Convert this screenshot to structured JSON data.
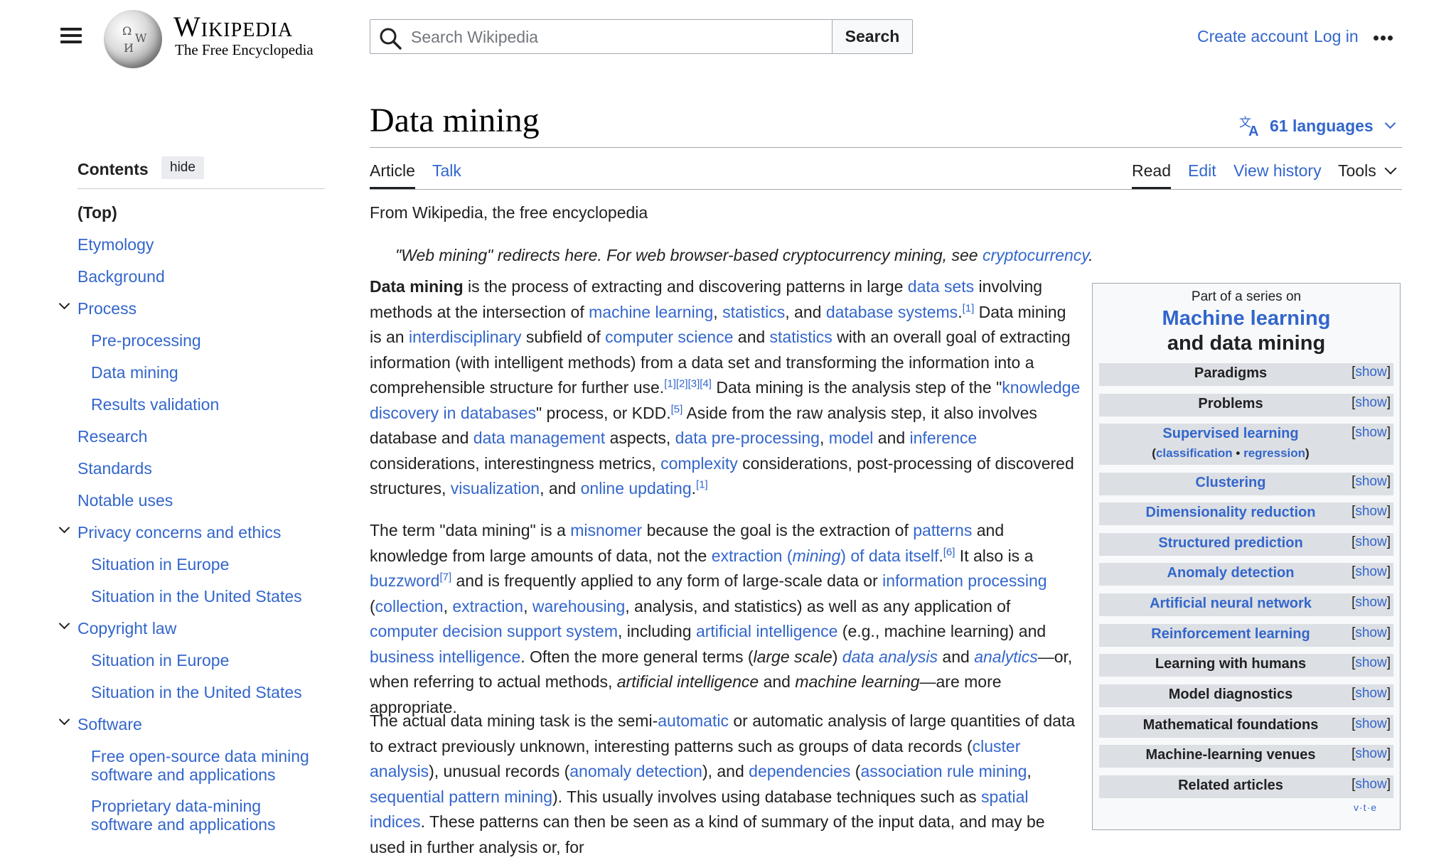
{
  "header": {
    "logo_wordmark": "Wikipedia",
    "logo_tagline": "The Free Encyclopedia",
    "search_placeholder": "Search Wikipedia",
    "search_button": "Search",
    "create_account": "Create account",
    "log_in": "Log in"
  },
  "page": {
    "title": "Data mining",
    "languages": "61 languages",
    "tabs_left": [
      "Article",
      "Talk"
    ],
    "tabs_right": [
      "Read",
      "Edit",
      "View history",
      "Tools"
    ]
  },
  "toc": {
    "title": "Contents",
    "hide": "hide",
    "items": [
      {
        "label": "(Top)"
      },
      {
        "label": "Etymology"
      },
      {
        "label": "Background"
      },
      {
        "label": "Process"
      },
      {
        "label": "Pre-processing"
      },
      {
        "label": "Data mining"
      },
      {
        "label": "Results validation"
      },
      {
        "label": "Research"
      },
      {
        "label": "Standards"
      },
      {
        "label": "Notable uses"
      },
      {
        "label": "Privacy concerns and ethics"
      },
      {
        "label": "Situation in Europe"
      },
      {
        "label": "Situation in the United States"
      },
      {
        "label": "Copyright law"
      },
      {
        "label": "Situation in Europe"
      },
      {
        "label": "Situation in the United States"
      },
      {
        "label": "Software"
      },
      {
        "label": "Free open-source data mining software and applications"
      },
      {
        "label": "Proprietary data-mining software and applications"
      }
    ]
  },
  "article": {
    "from": "From Wikipedia, the free encyclopedia",
    "hatnote_text": "\"Web mining\" redirects here. For web browser-based cryptocurrency mining, see ",
    "hatnote_link": "cryptocurrency",
    "hatnote_end": ".",
    "p1": [
      {
        "b": "Data mining"
      },
      {
        "t": " is the process of extracting and discovering patterns in large "
      },
      {
        "a": "data sets"
      },
      {
        "t": " involving methods at the intersection of "
      },
      {
        "a": "machine learning"
      },
      {
        "t": ", "
      },
      {
        "a": "statistics"
      },
      {
        "t": ", and "
      },
      {
        "a": "database systems"
      },
      {
        "t": "."
      },
      {
        "s": "[1]"
      },
      {
        "t": " Data mining is an "
      },
      {
        "a": "interdisciplinary"
      },
      {
        "t": " subfield of "
      },
      {
        "a": "computer science"
      },
      {
        "t": " and "
      },
      {
        "a": "statistics"
      },
      {
        "t": " with an overall goal of extracting information (with intelligent methods) from a data set and transforming the information into a comprehensible structure for further use."
      },
      {
        "s": "[1][2][3][4]"
      },
      {
        "t": " Data mining is the analysis step of the \""
      },
      {
        "a": "knowledge discovery in databases"
      },
      {
        "t": "\" process, or KDD."
      },
      {
        "s": "[5]"
      },
      {
        "t": " Aside from the raw analysis step, it also involves database and "
      },
      {
        "a": "data management"
      },
      {
        "t": " aspects, "
      },
      {
        "a": "data pre-processing"
      },
      {
        "t": ", "
      },
      {
        "a": "model"
      },
      {
        "t": " and "
      },
      {
        "a": "inference"
      },
      {
        "t": " considerations, interestingness metrics, "
      },
      {
        "a": "complexity"
      },
      {
        "t": " considerations, post-processing of discovered structures, "
      },
      {
        "a": "visualization"
      },
      {
        "t": ", and "
      },
      {
        "a": "online updating"
      },
      {
        "t": "."
      },
      {
        "s": "[1]"
      }
    ],
    "p2": [
      {
        "t": "The term \"data mining\" is a "
      },
      {
        "a": "misnomer"
      },
      {
        "t": " because the goal is the extraction of "
      },
      {
        "a": "patterns"
      },
      {
        "t": " and knowledge from large amounts of data, not the "
      },
      {
        "a": "extraction ("
      },
      {
        "ai": "mining"
      },
      {
        "a": ") of data itself"
      },
      {
        "t": "."
      },
      {
        "s": "[6]"
      },
      {
        "t": " It also is a "
      },
      {
        "a": "buzzword"
      },
      {
        "s": "[7]"
      },
      {
        "t": " and is frequently applied to any form of large-scale data or "
      },
      {
        "a": "information processing"
      },
      {
        "t": " ("
      },
      {
        "a": "collection"
      },
      {
        "t": ", "
      },
      {
        "a": "extraction"
      },
      {
        "t": ", "
      },
      {
        "a": "warehousing"
      },
      {
        "t": ", analysis, and statistics) as well as any application of "
      },
      {
        "a": "computer decision support system"
      },
      {
        "t": ", including "
      },
      {
        "a": "artificial intelligence"
      },
      {
        "t": " (e.g., machine learning) and "
      },
      {
        "a": "business intelligence"
      },
      {
        "t": ". Often the more general terms ("
      },
      {
        "i": "large scale"
      },
      {
        "t": ") "
      },
      {
        "ai": "data analysis"
      },
      {
        "t": " and "
      },
      {
        "ai": "analytics"
      },
      {
        "t": "—or, when referring to actual methods, "
      },
      {
        "i": "artificial intelligence"
      },
      {
        "t": " and "
      },
      {
        "i": "machine learning"
      },
      {
        "t": "—are more appropriate."
      }
    ],
    "p3": [
      {
        "t": "The actual data mining task is the semi-"
      },
      {
        "a": "automatic"
      },
      {
        "t": " or automatic analysis of large quantities of data to extract previously unknown, interesting patterns such as groups of data records ("
      },
      {
        "a": "cluster analysis"
      },
      {
        "t": "), unusual records ("
      },
      {
        "a": "anomaly detection"
      },
      {
        "t": "), and "
      },
      {
        "a": "dependencies"
      },
      {
        "t": " ("
      },
      {
        "a": "association rule mining"
      },
      {
        "t": ", "
      },
      {
        "a": "sequential pattern mining"
      },
      {
        "t": "). This usually involves using database techniques such as "
      },
      {
        "a": "spatial indices"
      },
      {
        "t": ". These patterns can then be seen as a kind of summary of the input data, and may be used in further analysis or, for"
      }
    ]
  },
  "infobox": {
    "above": "Part of a series on",
    "title_link": "Machine learning",
    "title_rest": "and data mining",
    "rows": [
      {
        "label": "Paradigms",
        "link": false
      },
      {
        "label": "Problems",
        "link": false
      },
      {
        "label": "Supervised learning",
        "link": true,
        "sub": [
          "classification",
          "regression"
        ]
      },
      {
        "label": "Clustering",
        "link": true
      },
      {
        "label": "Dimensionality reduction",
        "link": true
      },
      {
        "label": "Structured prediction",
        "link": true
      },
      {
        "label": "Anomaly detection",
        "link": true
      },
      {
        "label": "Artificial neural network",
        "link": true
      },
      {
        "label": "Reinforcement learning",
        "link": true
      },
      {
        "label": "Learning with humans",
        "link": false
      },
      {
        "label": "Model diagnostics",
        "link": false
      },
      {
        "label": "Mathematical foundations",
        "link": false
      },
      {
        "label": "Machine-learning venues",
        "link": false
      },
      {
        "label": "Related articles",
        "link": false
      }
    ],
    "show": "show",
    "vte": [
      "v",
      "t",
      "e"
    ]
  },
  "colors": {
    "link": "#3366cc",
    "text": "#202122",
    "border": "#a2a9b1",
    "infobox_row": "#dcdfe3"
  }
}
